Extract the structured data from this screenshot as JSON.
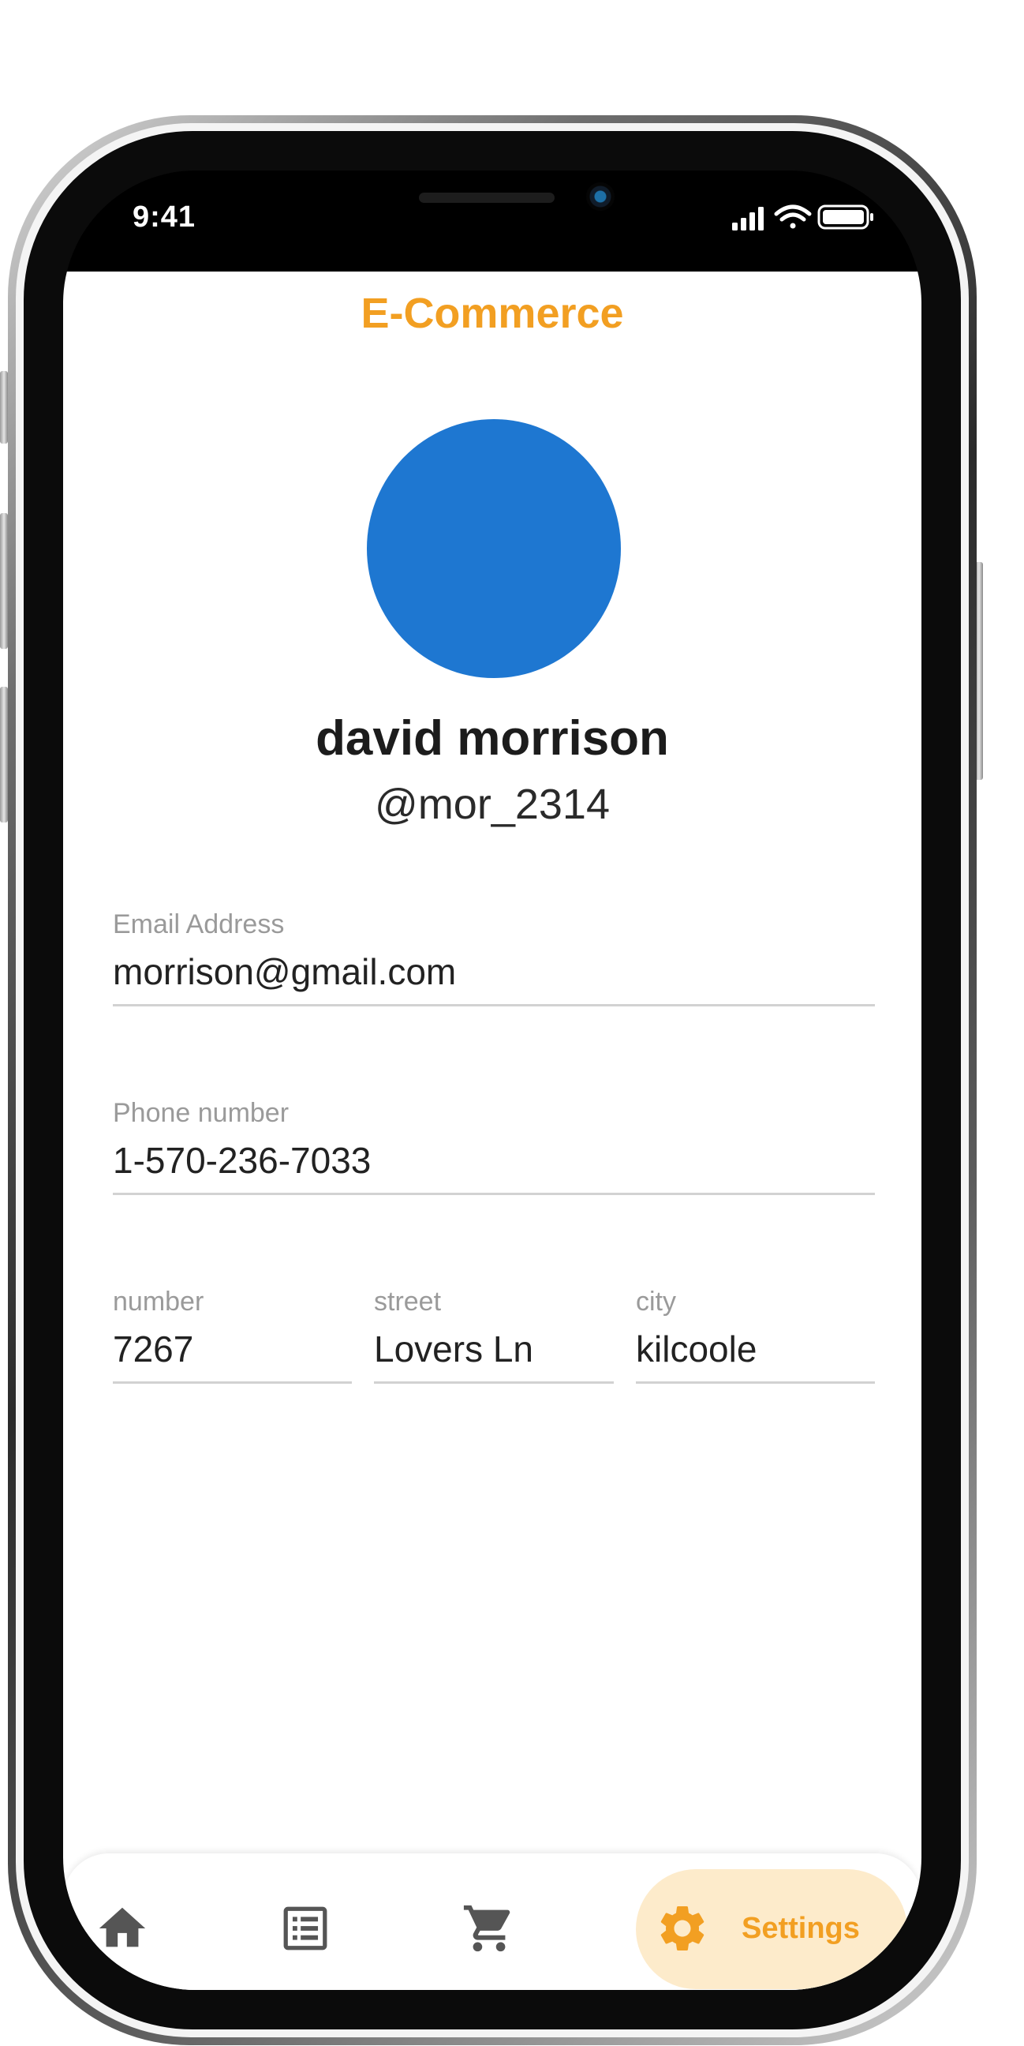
{
  "status_bar": {
    "time": "9:41"
  },
  "app": {
    "title": "E-Commerce",
    "accent_color": "#f29f22",
    "avatar_color": "#1e77d1"
  },
  "profile": {
    "name": "david morrison",
    "username": "@mor_2314"
  },
  "fields": {
    "email": {
      "label": "Email Address",
      "value": "morrison@gmail.com"
    },
    "phone": {
      "label": "Phone number",
      "value": "1-570-236-7033"
    },
    "number": {
      "label": "number",
      "value": "7267"
    },
    "street": {
      "label": "street",
      "value": "Lovers Ln"
    },
    "city": {
      "label": "city",
      "value": "kilcoole"
    }
  },
  "bottom_nav": {
    "items": [
      {
        "icon": "home-icon"
      },
      {
        "icon": "list-icon"
      },
      {
        "icon": "cart-icon"
      },
      {
        "icon": "gear-icon",
        "label": "Settings",
        "active": true
      }
    ]
  }
}
